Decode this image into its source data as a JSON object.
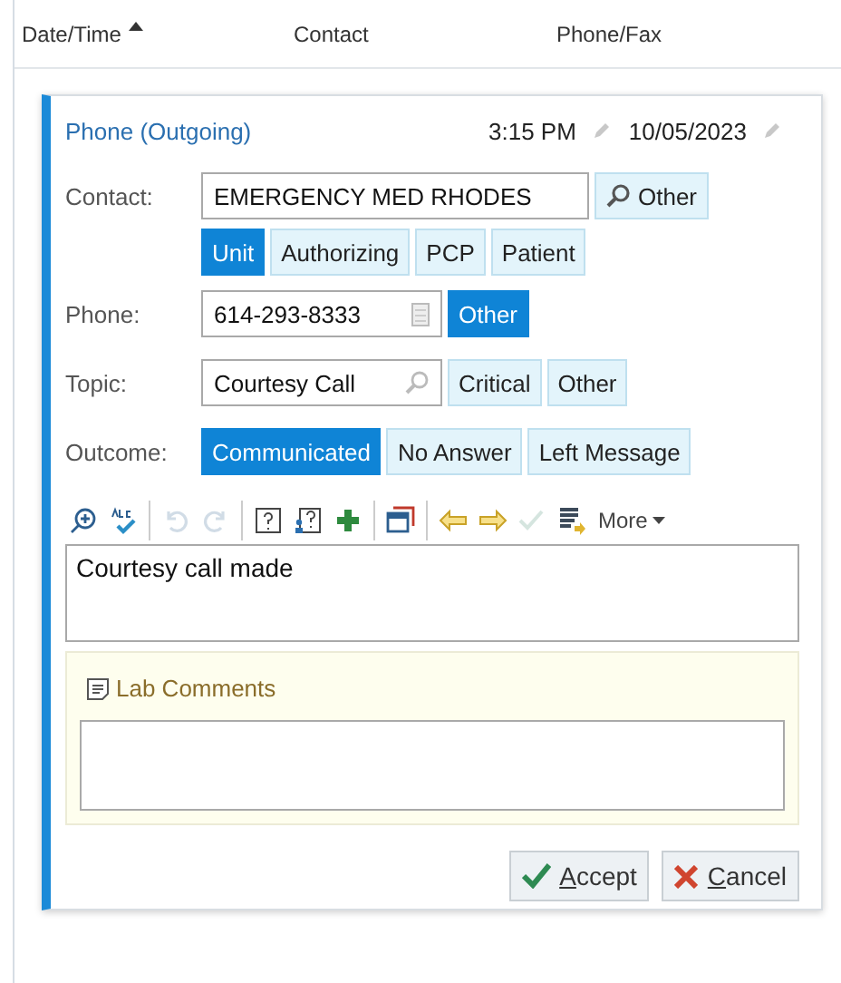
{
  "table": {
    "columns": [
      {
        "label": "Date/Time",
        "sorted": true
      },
      {
        "label": "Contact",
        "sorted": false
      },
      {
        "label": "Phone/Fax",
        "sorted": false
      }
    ]
  },
  "card": {
    "title": "Phone (Outgoing)",
    "time": "3:15 PM",
    "date": "10/05/2023",
    "contact": {
      "label": "Contact:",
      "value": "EMERGENCY MED RHODES",
      "button": "Other",
      "options": [
        {
          "label": "Unit",
          "selected": true
        },
        {
          "label": "Authorizing",
          "selected": false
        },
        {
          "label": "PCP",
          "selected": false
        },
        {
          "label": "Patient",
          "selected": false
        }
      ]
    },
    "phone": {
      "label": "Phone:",
      "value": "614-293-8333",
      "options": [
        {
          "label": "Other",
          "selected": true
        }
      ]
    },
    "topic": {
      "label": "Topic:",
      "value": "Courtesy Call",
      "options": [
        {
          "label": "Critical",
          "selected": false
        },
        {
          "label": "Other",
          "selected": false
        }
      ]
    },
    "outcome": {
      "label": "Outcome:",
      "options": [
        {
          "label": "Communicated",
          "selected": true
        },
        {
          "label": "No Answer",
          "selected": false
        },
        {
          "label": "Left Message",
          "selected": false
        }
      ]
    },
    "toolbar": {
      "items": [
        {
          "disabled": false
        },
        {
          "disabled": false
        },
        {
          "disabled": true
        },
        {
          "disabled": true
        },
        {
          "disabled": false
        },
        {
          "disabled": false
        },
        {
          "disabled": false
        },
        {
          "disabled": false
        },
        {
          "disabled": false
        },
        {
          "disabled": false
        },
        {
          "disabled": true
        },
        {
          "disabled": false
        }
      ],
      "more": "More"
    },
    "note": "Courtesy call made",
    "lab_comments": {
      "title": "Lab Comments"
    },
    "buttons": [
      {
        "kind": "accept",
        "key": "A",
        "rest": "ccept"
      },
      {
        "kind": "cancel",
        "key": "C",
        "rest": "ancel"
      }
    ]
  }
}
